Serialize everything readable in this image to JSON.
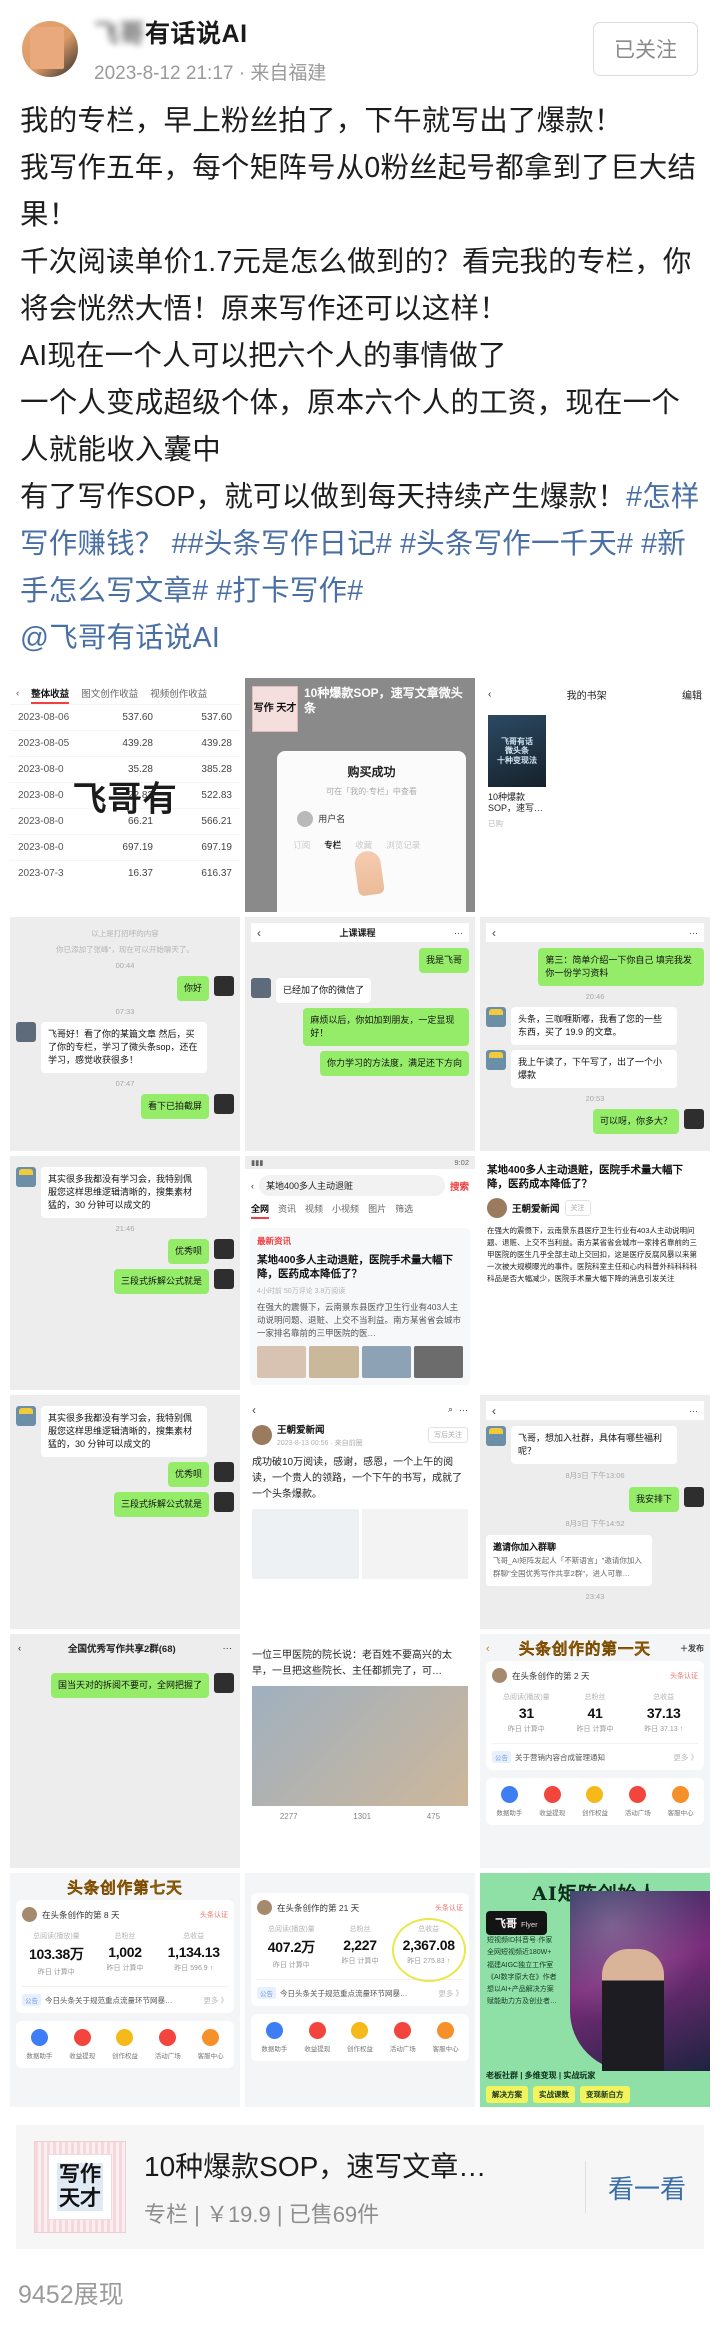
{
  "header": {
    "author_name_masked": "飞哥",
    "author_name_visible": "有话说AI",
    "timestamp": "2023-8-12 21:17 · 来自福建",
    "follow_label": "已关注"
  },
  "post": {
    "lines": [
      "我的专栏，早上粉丝拍了，下午就写出了爆款！",
      "我写作五年，每个矩阵号从0粉丝起号都拿到了巨大结果！",
      "千次阅读单价1.7元是怎么做到的？看完我的专栏，你将会恍然大悟！原来写作还可以这样！",
      "AI现在一个人可以把六个人的事情做了",
      "一个人变成超级个体，原本六个人的工资，现在一个人就能收入囊中",
      "有了写作SOP，就可以做到每天持续产生爆款！"
    ],
    "tags": "#怎样写作赚钱？ ##头条写作日记# #头条写作一千天# #新手怎么写文章# #打卡写作#",
    "mention": "@飞哥有话说AI"
  },
  "gallery": {
    "income": {
      "tabs": [
        "整体收益",
        "图文创作收益",
        "视频创作收益"
      ],
      "active_tab": "整体收益",
      "rows": [
        {
          "date": "2023-08-06",
          "v1": "537.60",
          "v2": "537.60"
        },
        {
          "date": "2023-08-05",
          "v1": "439.28",
          "v2": "439.28"
        },
        {
          "date": "2023-08-0",
          "v1": "35.28",
          "v2": "385.28"
        },
        {
          "date": "2023-08-0",
          "v1": "22.83",
          "v2": "522.83"
        },
        {
          "date": "2023-08-0",
          "v1": "66.21",
          "v2": "566.21"
        },
        {
          "date": "2023-08-0",
          "v1": "697.19",
          "v2": "697.19"
        },
        {
          "date": "2023-07-3",
          "v1": "16.37",
          "v2": "616.37"
        }
      ],
      "watermark": "飞哥有"
    },
    "purchase": {
      "cover_text": "写作 天才",
      "product_title": "10种爆款SOP，速写文章微头条",
      "modal_title": "购买成功",
      "modal_sub": "可在「我的-专栏」中查看",
      "user_name": "用户名",
      "tabs": [
        "订阅",
        "专栏",
        "收藏",
        "浏览记录"
      ],
      "active_tab": "专栏"
    },
    "bookshelf": {
      "nav_title": "我的书架",
      "edit_label": "编辑",
      "cover_line1": "微头条",
      "cover_line2": "十种变现法",
      "cover_owner": "飞哥有话",
      "item_title": "10种爆款SOP，速写…",
      "item_status": "已购"
    },
    "chat1": {
      "system_line": "以上是打招呼的内容",
      "system_line2": "你已添加了张峰\"，现在可以开始聊天了。",
      "messages": [
        {
          "time": "00:44"
        },
        {
          "side": "right",
          "text": "你好"
        },
        {
          "time": "07:33"
        },
        {
          "side": "left",
          "text": "飞哥好！看了你的某篇文章 然后，买了你的专栏，学习了微头条sop，还在学习，感觉收获很多！"
        },
        {
          "time": "07:47"
        },
        {
          "side": "right",
          "text": "看下已拍截屏"
        }
      ]
    },
    "chat2": {
      "messages": [
        {
          "side": "right",
          "text": "我是飞哥"
        },
        {
          "side": "left",
          "text": "已经加了你的微信了"
        },
        {
          "side": "right",
          "text": "麻烦以后，你如加到朋友，一定显现好！"
        },
        {
          "side": "left",
          "text": "你力学习的方法度，满足还下方向"
        }
      ]
    },
    "chat3": {
      "messages": [
        {
          "side": "right",
          "text": "第三：简单介绍一下你自己 填完我发你一份学习资料"
        },
        {
          "time": "20:46"
        },
        {
          "side": "left",
          "text": "头条，三咖喱斯嘟，我看了您的一些东西，买了 19.9 的文章。"
        },
        {
          "side": "left",
          "text": "我上午读了，下午写了，出了一个小爆款"
        },
        {
          "time": "20:53"
        },
        {
          "side": "right",
          "text": "可以呀，你多大？"
        }
      ]
    },
    "chat4": {
      "messages": [
        {
          "side": "left",
          "text": "其实很多我都没有学习会，我特别佩服您这样思维逻辑清晰的，搜集素材猛的，30 分钟可以成文的"
        },
        {
          "time": "21:46"
        },
        {
          "side": "right",
          "text": "优秀呗"
        },
        {
          "side": "right",
          "text": "三段式拆解公式就是"
        }
      ]
    },
    "chat5": {
      "messages": [
        {
          "side": "left",
          "text": "其实很多我都没有学习会，我特别佩服您这样思维逻辑清晰的，搜集素材猛的，30 分钟可以成文的"
        },
        {
          "side": "right",
          "text": "优秀呗"
        },
        {
          "side": "right",
          "text": "三段式拆解公式就是"
        }
      ]
    },
    "chat6": {
      "nav_title": "",
      "messages": [
        {
          "side": "left",
          "text": "飞哥，想加入社群，具体有哪些福利呢？"
        },
        {
          "time": "8月3日 下午13:06"
        },
        {
          "side": "right",
          "text": "我安排下"
        },
        {
          "time": "8月3日 下午14:52"
        },
        {
          "side": "left",
          "text": "邀请你加入群聊"
        },
        {
          "side": "left",
          "text": "飞哥_AI矩阵发起人「不斯语言」\"邀请你加入群聊\"全国优秀写作共享2群\"，进人可靠…"
        },
        {
          "time": "23:43"
        }
      ]
    },
    "group": {
      "nav_title": "全国优秀写作共享2群(68)",
      "message": "国当天对的拆阅不要可，全网把握了"
    },
    "news": {
      "status_time": "9:02",
      "search_value": "某地400多人主动退赃",
      "search_button": "搜索",
      "tabs": [
        "全网",
        "资讯",
        "视频",
        "小视频",
        "图片",
        "筛选"
      ],
      "active_tab": "全网",
      "flag": "最新资讯",
      "title": "某地400多人主动退赃，医院手术量大幅下降，医药成本降低了？",
      "meta": "4小时前  50万评论  3.8万阅读",
      "text": "在强大的震慑下，云南景东县医疗卫生行业有403人主动说明问题、退赃、上交不当利益。南方某省省会城市一家排名靠前的三甲医院的医…"
    },
    "article_right": {
      "title": "某地400多人主动退赃，医院手术量大幅下降，医药成本降低了？",
      "author": "王朝爱新闻",
      "follow": "关注",
      "text": "在强大的震慑下，云南景东县医疗卫生行业有403人主动说明问题、退赃、上交不当利益。南方某省省会城市一家排名靠前的三甲医院的医生几乎全部主动上交回扣，这是医疗反腐风暴以来第一次被大规模曝光的事件。医院科室主任和心内科普外科科科科科品是否大幅减少，医院手术量大幅下降的消息引发关注"
    },
    "article_mid": {
      "author": "王朝爱新闻",
      "time": "2023-8-13 00:56 · 来自前圈",
      "follow": "写后关注",
      "text": "成功破10万阅读，感谢，感恩，一个上午的阅读，一个贵人的领路，一个下午的书写，成就了一个头条爆款。"
    },
    "article_bottom": {
      "text": "一位三甲医院的院长说：老百姓不要高兴的太早，一旦把这些院长、主任都抓完了，可…",
      "stats": [
        "2277",
        "1301",
        "475"
      ]
    },
    "chat_invite": {
      "title": "邀请你加入群聊",
      "text": "飞哥_AI矩阵发起人「不斯语言」\"邀请你加入群聊\"全国优秀写作共享2群\"，进人可靠…"
    },
    "stats_day1": {
      "banner": "头条创作的第一天",
      "publish_label": "＋发布",
      "who": "在头条创作的第 2 天",
      "cert": "头条认证",
      "labels": [
        "总阅读(播放)量",
        "总粉丝",
        "总收益"
      ],
      "values": [
        "31",
        "41",
        "37.13"
      ],
      "subs": [
        "昨日 计算中",
        "昨日 计算中",
        "昨日 37.13 ↑"
      ],
      "notice_pill": "公告",
      "notice": "关于营销内容合成管理通知",
      "more": "更多 》",
      "icons": [
        "数据助手",
        "收益提现",
        "创作权益",
        "活动广场",
        "客服中心"
      ]
    },
    "stats_day7": {
      "banner": "头条创作第七天",
      "who": "在头条创作的第 8 天",
      "cert": "头条认证",
      "labels": [
        "总阅读(播放)量",
        "总粉丝",
        "总收益"
      ],
      "values": [
        "103.38万",
        "1,002",
        "1,134.13"
      ],
      "subs": [
        "昨日 计算中",
        "昨日 计算中",
        "昨日 596.9 ↑"
      ],
      "notice_pill": "公告",
      "notice": "今日头条关于规范重点流量环节网暴…",
      "more": "更多 》",
      "icons": [
        "数据助手",
        "收益提现",
        "创作权益",
        "活动广场",
        "客服中心"
      ]
    },
    "stats_day21": {
      "who": "在头条创作的第 21 天",
      "cert": "头条认证",
      "labels": [
        "总阅读(播放)量",
        "总粉丝",
        "总收益"
      ],
      "values": [
        "407.2万",
        "2,227",
        "2,367.08"
      ],
      "subs": [
        "昨日 计算中",
        "昨日 计算中",
        "昨日 275.83 ↑"
      ],
      "notice_pill": "公告",
      "notice": "今日头条关于规范重点流量环节网暴…",
      "more": "更多 》",
      "icons": [
        "数据助手",
        "收益提现",
        "创作权益",
        "活动广场",
        "客服中心"
      ]
    },
    "poster": {
      "title": "AI矩阵创始人",
      "badge_name": "飞哥",
      "badge_en": "Flyer",
      "bullets": [
        "短视频ID抖音号·作家",
        "全网短视频近180W+",
        "福建AIGC独立工作室",
        "《AI数字原大在》作者",
        "想以AI+产品解决方案",
        "赋能助力方及创业者…"
      ],
      "foot_line": "老板社群 | 多维变现 | 实战玩家",
      "chips": [
        "解决方案",
        "实战课数",
        "变现新白方"
      ]
    }
  },
  "product": {
    "cover_line1": "写作",
    "cover_line2": "天才",
    "title": "10种爆款SOP，速写文章…",
    "sub": "专栏 | ￥19.9 | 已售69件",
    "cta": "看一看"
  },
  "footer": {
    "views": "9452展现"
  },
  "colors": {
    "link": "#4a6fa5",
    "accent_red": "#f04142",
    "wechat_green": "#95ec69",
    "gold": "#e8a319"
  }
}
